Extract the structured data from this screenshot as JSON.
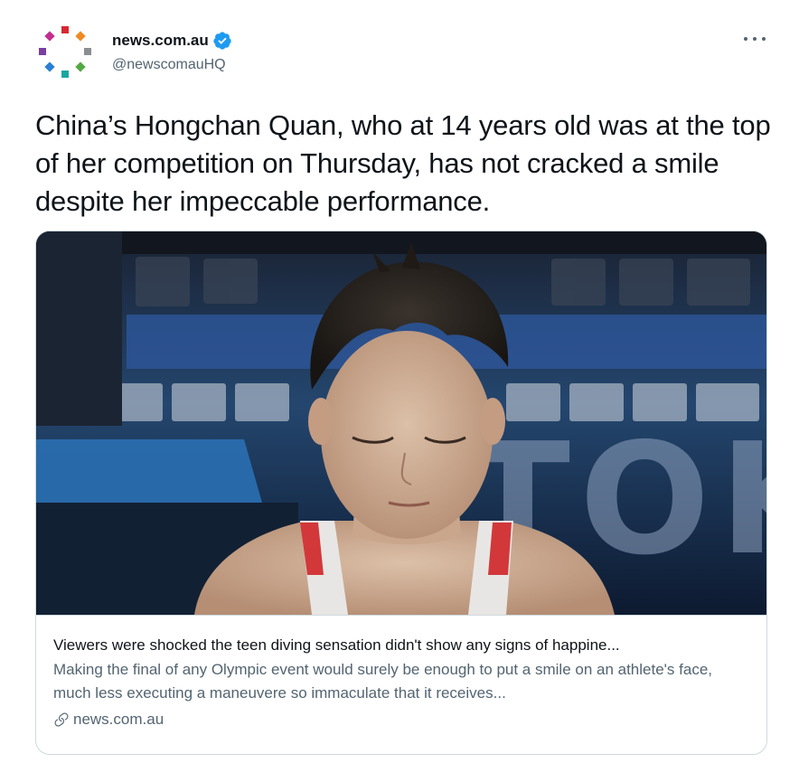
{
  "author": {
    "display_name": "news.com.au",
    "handle": "@newscomauHQ",
    "verified": true
  },
  "tweet": {
    "text": "China’s Hongchan Quan, who at 14 years old was at the top of her competition on Thursday, has not cracked a smile despite her impeccable performance."
  },
  "card": {
    "image_overlay_text": "TOKY",
    "title": "Viewers were shocked the teen diving sensation didn't show any signs of happine...",
    "description": "Making the final of any Olympic event would surely be enough to put a smile on an athlete's face, much less executing a maneuvere so immaculate that it receives...",
    "domain": "news.com.au"
  },
  "icons": {
    "verified": "verified-badge-icon",
    "more": "more-options-icon",
    "link": "link-icon"
  },
  "colors": {
    "verified_blue": "#1d9bf0",
    "secondary_text": "#536471",
    "border": "#cfd9de"
  }
}
